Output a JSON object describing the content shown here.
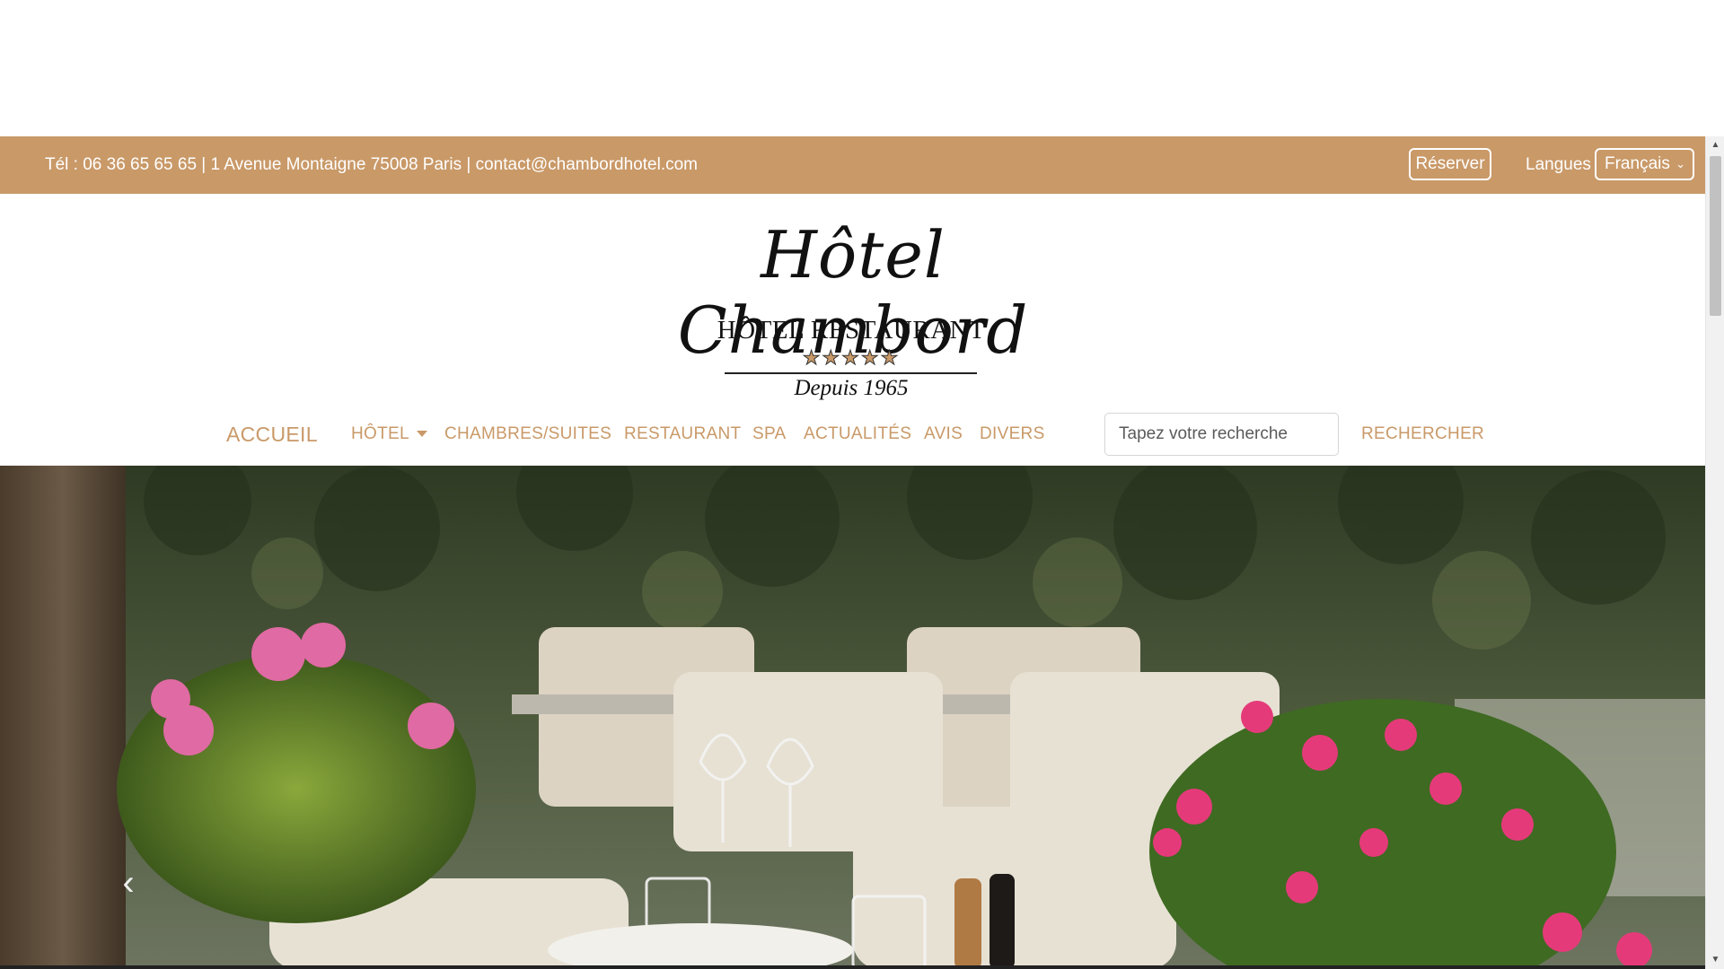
{
  "topbar": {
    "contact_text": "Tél : 06 36 65 65 65 | 1 Avenue Montaigne 75008 Paris | contact@chambordhotel.com",
    "reserve_label": "Réserver",
    "languages_label": "Langues",
    "language_selected": "Français"
  },
  "logo": {
    "script_title": "Hôtel  Chambord",
    "subtitle": "HÔTEL RESTAURANT",
    "stars": "★★★★★",
    "since": "Depuis 1965"
  },
  "nav": {
    "items": [
      {
        "label": "ACCUEIL"
      },
      {
        "label": "HÔTEL"
      },
      {
        "label": "CHAMBRES/SUITES"
      },
      {
        "label": "RESTAURANT"
      },
      {
        "label": "SPA"
      },
      {
        "label": "ACTUALITÉS"
      },
      {
        "label": "AVIS"
      },
      {
        "label": "DIVERS"
      }
    ],
    "search_placeholder": "Tapez votre recherche",
    "search_button": "RECHERCHER"
  },
  "hero": {
    "prev_glyph": "‹"
  },
  "colors": {
    "brand": "#c99968",
    "text_dark": "#111111"
  }
}
